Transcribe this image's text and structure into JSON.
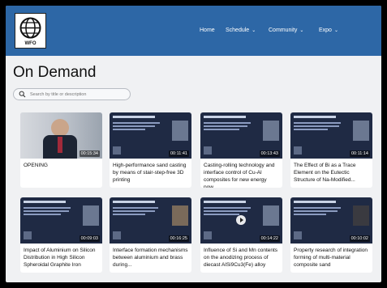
{
  "header": {
    "logo_text": "WFO",
    "nav": [
      {
        "label": "Home",
        "has_dropdown": false
      },
      {
        "label": "Schedule",
        "has_dropdown": true
      },
      {
        "label": "Community",
        "has_dropdown": true
      },
      {
        "label": "Expo",
        "has_dropdown": true
      }
    ],
    "bar_color": "#2d67a6"
  },
  "page": {
    "title": "On Demand",
    "search_placeholder": "Search by title or description"
  },
  "cards": [
    {
      "title": "OPENING",
      "duration": "00:15:34",
      "kind": "photo"
    },
    {
      "title": "High-performance sand casting by means of stair-step-free 3D printing",
      "duration": "00:11:41",
      "kind": "slide"
    },
    {
      "title": "Casting-rolling technology and interface control of Cu-Al composites for new energy pow...",
      "duration": "00:13:43",
      "kind": "slide"
    },
    {
      "title": "The Effect of Bi as a Trace Element on the Eutectic Structure of Na-Modified...",
      "duration": "00:11:14",
      "kind": "slide"
    },
    {
      "title": "Impact of Aluminium on Silicon Distribution in High Silicon Spheroidal Graphite Iron",
      "duration": "00:09:03",
      "kind": "slide"
    },
    {
      "title": "Interface formation mechanisms between aluminium and brass during...",
      "duration": "00:16:25",
      "kind": "slide"
    },
    {
      "title": "Influence of Si and Mn contents on the anodizing process of diecast AlSi9Cu3(Fe) alloy",
      "duration": "00:14:22",
      "kind": "slide_play"
    },
    {
      "title": "Property research of integration forming of multi-material composite sand",
      "duration": "00:10:02",
      "kind": "slide"
    }
  ]
}
